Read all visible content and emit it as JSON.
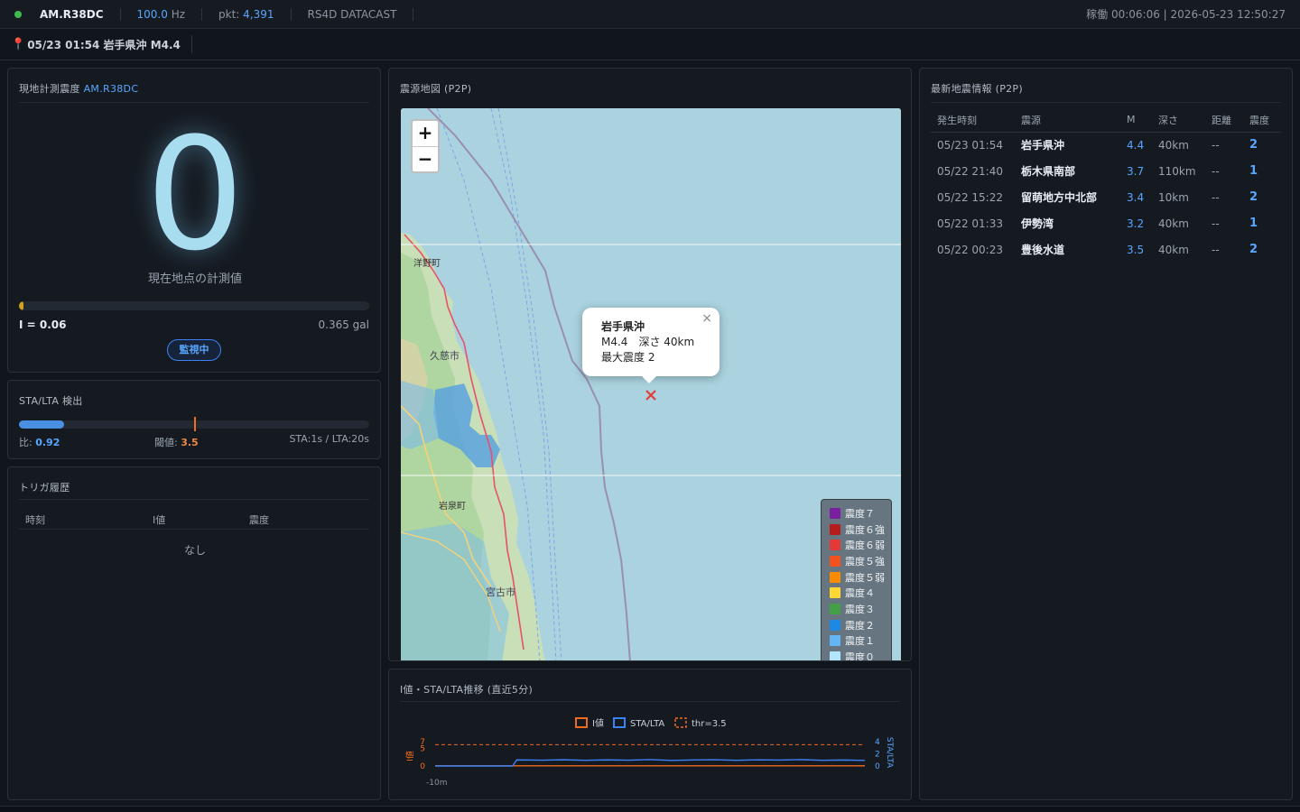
{
  "topbar": {
    "station": "AM.R38DC",
    "rate_value": "100.0",
    "rate_unit": "Hz",
    "pkt_label": "pkt:",
    "pkt_value": "4,391",
    "source": "RS4D DATACAST",
    "uptime_clock": "稼働 00:06:06 | 2026-05-23 12:50:27",
    "status_color": "#3fb950"
  },
  "alert": {
    "icon": "pin-icon",
    "text": "05/23 01:54 岩手県沖 M4.4"
  },
  "intensity_panel": {
    "title": "現地計測震度",
    "station": "AM.R38DC",
    "value": "0",
    "caption": "現在地点の計測値",
    "i_value": "I = 0.06",
    "gal": "0.365 gal",
    "bar_fraction": 0.01,
    "status": "監視中"
  },
  "sta_panel": {
    "title": "STA/LTA 検出",
    "ratio_label": "比:",
    "ratio_value": "0.92",
    "threshold_label": "閾値:",
    "threshold_value": "3.5",
    "window": "STA:1s / LTA:20s",
    "ratio_fraction": 0.13,
    "threshold_fraction": 0.5
  },
  "trigger_panel": {
    "title": "トリガ履歴",
    "columns": [
      "時刻",
      "I値",
      "震度"
    ],
    "empty": "なし"
  },
  "map_panel": {
    "title": "震源地図 (P2P)",
    "zoom_in": "+",
    "zoom_out": "−",
    "places": [
      "洋野町",
      "久慈市",
      "岩泉町",
      "宮古市"
    ],
    "popup": {
      "title": "岩手県沖",
      "line1": "M4.4　深さ 40km",
      "line2": "最大震度 2",
      "close": "×"
    },
    "epicenter_icon": "epicenter-x-icon",
    "legend": [
      {
        "label": "震度７",
        "color": "#7b1fa2"
      },
      {
        "label": "震度６強",
        "color": "#b71c1c"
      },
      {
        "label": "震度６弱",
        "color": "#e53935"
      },
      {
        "label": "震度５強",
        "color": "#f4511e"
      },
      {
        "label": "震度５弱",
        "color": "#fb8c00"
      },
      {
        "label": "震度４",
        "color": "#fdd835"
      },
      {
        "label": "震度３",
        "color": "#43a047"
      },
      {
        "label": "震度２",
        "color": "#1e88e5"
      },
      {
        "label": "震度１",
        "color": "#64b5f6"
      },
      {
        "label": "震度０",
        "color": "#b3e5fc"
      }
    ]
  },
  "chart_panel": {
    "title": "I値・STA/LTA推移 (直近5分)"
  },
  "chart_data": {
    "type": "line",
    "title": "",
    "legend": [
      "I値",
      "STA/LTA",
      "thr=3.5"
    ],
    "legend_placement": "top-center",
    "xlabel": "",
    "x_tick_labels": [
      "-10m"
    ],
    "y_left_label": "I値",
    "y_left_ticks": [
      "7",
      "5",
      "0"
    ],
    "y_left_range": [
      0,
      7
    ],
    "y_right_label": "STA/LTA",
    "y_right_ticks": [
      "4",
      "2",
      "0"
    ],
    "y_right_range": [
      0,
      4
    ],
    "series": [
      {
        "name": "I値",
        "axis": "left",
        "color": "#f26b1d",
        "x": [
          -10,
          0
        ],
        "values": [
          0.06,
          0.06
        ]
      },
      {
        "name": "STA/LTA",
        "axis": "right",
        "color": "#3b82f6",
        "x": [
          -10,
          -8.2,
          -8.1,
          -7.5,
          -7,
          -6.5,
          -6,
          -5.5,
          -5,
          -4.5,
          -4,
          -3.5,
          -3,
          -2.5,
          -2,
          -1.5,
          -1,
          -0.5,
          0
        ],
        "values": [
          0,
          0,
          1.0,
          0.95,
          1.02,
          0.93,
          1.0,
          0.96,
          1.04,
          0.92,
          0.99,
          1.03,
          0.94,
          1.01,
          0.97,
          1.05,
          0.93,
          0.98,
          0.92
        ]
      },
      {
        "name": "thr=3.5",
        "axis": "right",
        "dashed": true,
        "color": "#f26b1d",
        "x": [
          -10,
          0
        ],
        "values": [
          3.5,
          3.5
        ]
      }
    ]
  },
  "list_panel": {
    "title": "最新地震情報 (P2P)",
    "columns": [
      "発生時刻",
      "震源",
      "M",
      "深さ",
      "距離",
      "震度"
    ],
    "rows": [
      {
        "time": "05/23 01:54",
        "region": "岩手県沖",
        "mag": "4.4",
        "depth": "40km",
        "dist": "--",
        "shindo": "2"
      },
      {
        "time": "05/22 21:40",
        "region": "栃木県南部",
        "mag": "3.7",
        "depth": "110km",
        "dist": "--",
        "shindo": "1"
      },
      {
        "time": "05/22 15:22",
        "region": "留萌地方中北部",
        "mag": "3.4",
        "depth": "10km",
        "dist": "--",
        "shindo": "2"
      },
      {
        "time": "05/22 01:33",
        "region": "伊勢湾",
        "mag": "3.2",
        "depth": "40km",
        "dist": "--",
        "shindo": "1"
      },
      {
        "time": "05/22 00:23",
        "region": "豊後水道",
        "mag": "3.5",
        "depth": "40km",
        "dist": "--",
        "shindo": "2"
      }
    ]
  }
}
